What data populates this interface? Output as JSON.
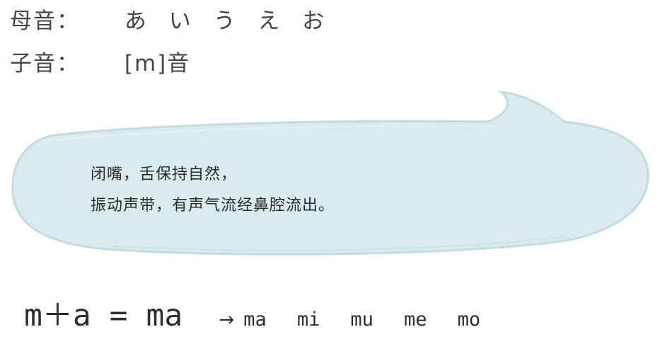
{
  "vowels": {
    "label": "母音：",
    "kana": [
      "あ",
      "い",
      "う",
      "え",
      "お"
    ]
  },
  "consonant": {
    "label": "子音：",
    "value": "[m]音"
  },
  "bubble": {
    "line1": "闭嘴，舌保持自然，",
    "line2": "振动声带，有声气流经鼻腔流出。",
    "fill_color": "#daebee",
    "edge_color": "#c2dce2"
  },
  "formula": {
    "equation": "m＋a = ma",
    "arrow": "→",
    "syllables": [
      "ma",
      "mi",
      "mu",
      "me",
      "mo"
    ]
  }
}
